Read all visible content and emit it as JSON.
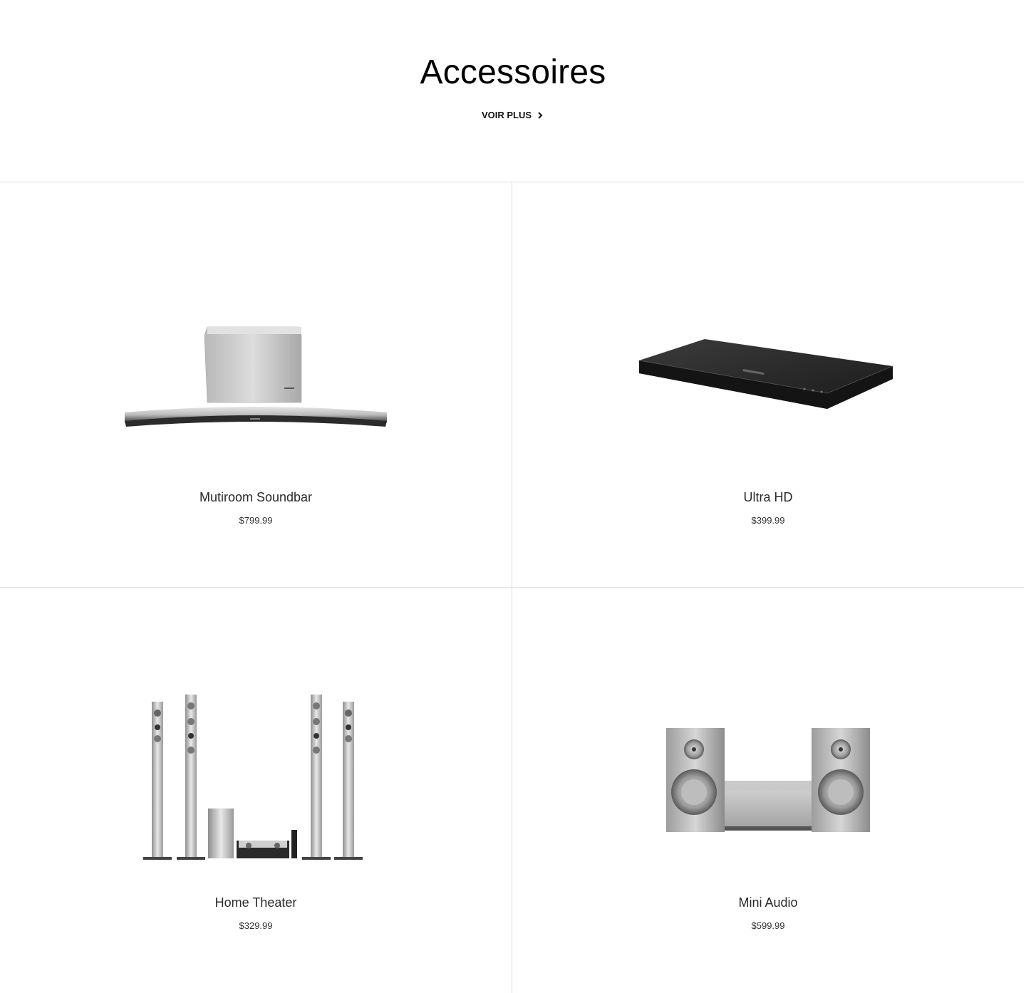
{
  "header": {
    "title": "Accessoires",
    "see_more_label": "VOIR PLUS",
    "see_more_icon": "chevron-right-icon"
  },
  "products": [
    {
      "name": "Mutiroom Soundbar",
      "price": "$799.99",
      "image": "curved-soundbar-with-subwoofer"
    },
    {
      "name": "Ultra HD",
      "price": "$399.99",
      "image": "blu-ray-player"
    },
    {
      "name": "Home Theater",
      "price": "$329.99",
      "image": "home-theater-tower-speakers"
    },
    {
      "name": "Mini Audio",
      "price": "$599.99",
      "image": "mini-audio-system"
    }
  ],
  "colors": {
    "divider": "#dddddd",
    "text": "#2a2a2a",
    "silver": "#c4c4c4",
    "dark": "#222222"
  }
}
